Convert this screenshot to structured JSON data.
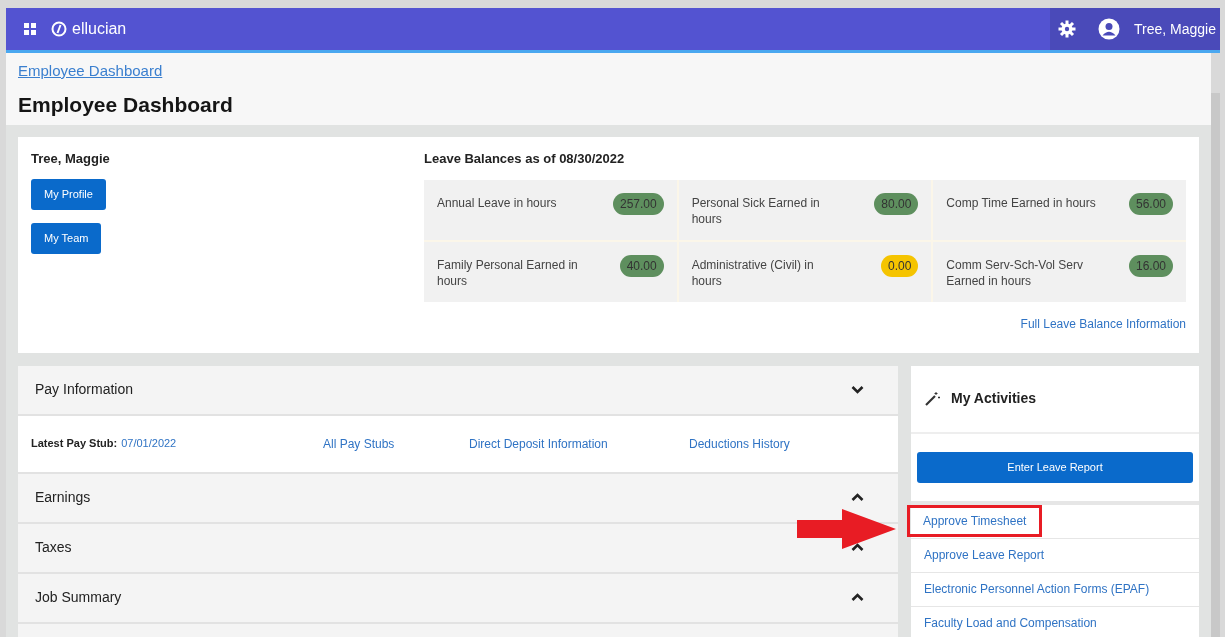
{
  "topbar": {
    "logo": "ellucian",
    "user": "Tree, Maggie"
  },
  "breadcrumb": "Employee Dashboard",
  "title": "Employee Dashboard",
  "profile": {
    "name": "Tree, Maggie",
    "buttons": [
      "My Profile",
      "My Team"
    ]
  },
  "leave": {
    "title": "Leave Balances as of 08/30/2022",
    "items": [
      {
        "label": "Annual Leave in hours",
        "value": "257.00",
        "color": "#5e8f5e"
      },
      {
        "label": "Personal Sick Earned in hours",
        "value": "80.00",
        "color": "#5e8f5e"
      },
      {
        "label": "Comp Time Earned in hours",
        "value": "56.00",
        "color": "#5e8f5e"
      },
      {
        "label": "Family Personal Earned in hours",
        "value": "40.00",
        "color": "#5e8f5e"
      },
      {
        "label": "Administrative (Civil) in hours",
        "value": "0.00",
        "color": "#f5c400"
      },
      {
        "label": "Comm Serv-Sch-Vol Serv Earned in hours",
        "value": "16.00",
        "color": "#5e8f5e"
      }
    ],
    "link": "Full Leave Balance Information"
  },
  "sections": [
    {
      "title": "Pay Information",
      "expanded": true,
      "stub_label": "Latest Pay Stub:",
      "stub_date": "07/01/2022",
      "links": [
        "All Pay Stubs",
        "Direct Deposit Information",
        "Deductions History"
      ]
    },
    {
      "title": "Earnings",
      "expanded": false
    },
    {
      "title": "Taxes",
      "expanded": false
    },
    {
      "title": "Job Summary",
      "expanded": false
    }
  ],
  "activities": {
    "title": "My Activities",
    "button": "Enter Leave Report",
    "items": [
      {
        "label": "Approve Timesheet",
        "highlighted": true
      },
      {
        "label": "Approve Leave Report",
        "highlighted": false
      },
      {
        "label": "Electronic Personnel Action Forms (EPAF)",
        "highlighted": false
      },
      {
        "label": "Faculty Load and Compensation",
        "highlighted": false
      }
    ]
  }
}
